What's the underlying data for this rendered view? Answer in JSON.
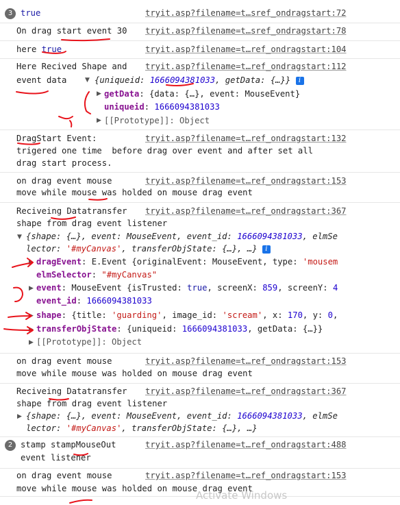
{
  "entries": [
    {
      "badge": "3",
      "lines": [
        "true"
      ],
      "src": "tryit.asp?filename=t…sref_ondragstart:72"
    },
    {
      "lines": [
        "On drag start event 30"
      ],
      "src": "tryit.asp?filename=t…sref_ondragstart:78"
    },
    {
      "lines": [
        "here true"
      ],
      "src": "tryit.asp?filename=t…ref_ondragstart:104"
    },
    {
      "lines": [
        "Here Recived Shape and",
        "event data"
      ],
      "src": "tryit.asp?filename=t…ref_ondragstart:112"
    },
    {
      "lines": [
        "DragStart Event:",
        "trigered one time  before drag over event and after set all",
        "drag start process."
      ],
      "src": "tryit.asp?filename=t…ref_ondragstart:132"
    },
    {
      "lines": [
        "on drag event mouse",
        "move while mouse was holded on mouse drag event"
      ],
      "src": "tryit.asp?filename=t…ref_ondragstart:153"
    },
    {
      "lines": [
        "Reciveing Datatransfer",
        "shape from drag event listener"
      ],
      "src": "tryit.asp?filename=t…ref_ondragstart:367"
    },
    {
      "lines": [
        "on drag event mouse",
        "move while mouse was holded on mouse drag event"
      ],
      "src": "tryit.asp?filename=t…ref_ondragstart:153"
    },
    {
      "lines": [
        "Reciveing Datatransfer",
        "shape from drag event listener"
      ],
      "src": "tryit.asp?filename=t…ref_ondragstart:367"
    },
    {
      "badge": "2",
      "lines": [
        "stamp stampMouseOut",
        "event listener"
      ],
      "src": "tryit.asp?filename=t…ref_ondragstart:488"
    },
    {
      "lines": [
        "on drag event mouse",
        "move while mouse was holded on mouse drag event"
      ],
      "src": "tryit.asp?filename=t…ref_ondragstart:153"
    }
  ],
  "obj1": {
    "summary_pre": "{uniqueid: ",
    "summary_id": "1666094381033",
    "summary_post": ", getData: {…}}",
    "getData_key": "getData",
    "getData_val": ": {data: {…}, event: MouseEvent}",
    "uniqueid_key": "uniqueid",
    "uniqueid_val": "1666094381033",
    "proto": "[[Prototype]]: Object"
  },
  "obj2": {
    "summary1_a": "{shape: {…}, event: MouseEvent, event_id: ",
    "summary1_id": "1666094381033",
    "summary1_b": ", elmSe",
    "summary2_a": "lector: ",
    "summary2_str": "'#myCanvas'",
    "summary2_b": ", transferObjState: {…}, …}",
    "dragEvent_key": "dragEvent",
    "dragEvent_val": ": E.Event {originalEvent: MouseEvent, type: ",
    "dragEvent_str": "'mousem",
    "elmSelector_key": "elmSelector",
    "elmSelector_val": "\"#myCanvas\"",
    "event_key": "event",
    "event_val_a": ": MouseEvent {isTrusted: ",
    "event_true": "true",
    "event_val_b": ", screenX: ",
    "event_x": "859",
    "event_val_c": ", screenY: ",
    "event_y": "4",
    "event_id_key": "event_id",
    "event_id_val": "1666094381033",
    "shape_key": "shape",
    "shape_a": ": {title: ",
    "shape_title": "'guarding'",
    "shape_b": ", image_id: ",
    "shape_img": "'scream'",
    "shape_c": ", x: ",
    "shape_x": "170",
    "shape_d": ", y: ",
    "shape_y": "0",
    "shape_e": ",",
    "tos_key": "transferObjState",
    "tos_a": ": {uniqueid: ",
    "tos_id": "1666094381033",
    "tos_b": ", getData: {…}}",
    "proto": "[[Prototype]]: Object"
  },
  "obj3": {
    "summary1_a": "{shape: {…}, event: MouseEvent, event_id: ",
    "summary1_id": "1666094381033",
    "summary1_b": ", elmSe",
    "summary2_a": "lector: ",
    "summary2_str": "'#myCanvas'",
    "summary2_b": ", transferObjState: {…}, …}"
  },
  "info_glyph": "i",
  "watermark": "Activate Windows",
  "colors": {
    "annotation": "#e8131b",
    "badge": "#6b6b6b",
    "info": "#1a73e8"
  }
}
